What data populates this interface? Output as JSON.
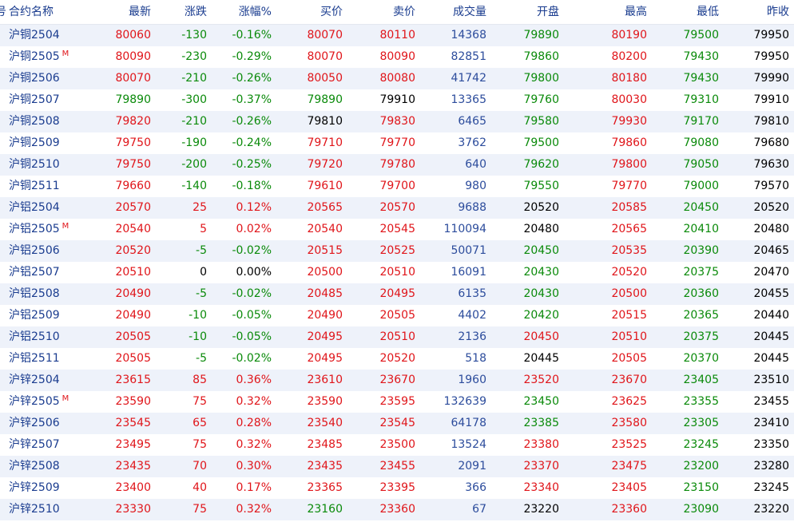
{
  "colors": {
    "up": "#e0151a",
    "down": "#0a8a0a",
    "flat": "#000000",
    "volume": "#2c4c9c",
    "name": "#1a3c8f"
  },
  "header": {
    "index_fragment": "号",
    "name": "合约名称",
    "last": "最新",
    "change": "涨跌",
    "change_pct": "涨幅%",
    "bid": "买价",
    "ask": "卖价",
    "volume": "成交量",
    "open": "开盘",
    "high": "最高",
    "low": "最低",
    "prev_close": "昨收"
  },
  "rows": [
    {
      "name": "沪铜2504",
      "main": "",
      "last": "80060",
      "change": "-130",
      "pct": "-0.16%",
      "bid": "80070",
      "ask": "80110",
      "volume": "14368",
      "open": "79890",
      "high": "80190",
      "low": "79500",
      "prev": "79950"
    },
    {
      "name": "沪铜2505",
      "main": "M",
      "last": "80090",
      "change": "-230",
      "pct": "-0.29%",
      "bid": "80070",
      "ask": "80090",
      "volume": "82851",
      "open": "79860",
      "high": "80200",
      "low": "79430",
      "prev": "79950"
    },
    {
      "name": "沪铜2506",
      "main": "",
      "last": "80070",
      "change": "-210",
      "pct": "-0.26%",
      "bid": "80050",
      "ask": "80080",
      "volume": "41742",
      "open": "79800",
      "high": "80180",
      "low": "79430",
      "prev": "79990"
    },
    {
      "name": "沪铜2507",
      "main": "",
      "last": "79890",
      "change": "-300",
      "pct": "-0.37%",
      "bid": "79890",
      "ask": "79910",
      "volume": "13365",
      "open": "79760",
      "high": "80030",
      "low": "79310",
      "prev": "79910"
    },
    {
      "name": "沪铜2508",
      "main": "",
      "last": "79820",
      "change": "-210",
      "pct": "-0.26%",
      "bid": "79810",
      "ask": "79830",
      "volume": "6465",
      "open": "79580",
      "high": "79930",
      "low": "79170",
      "prev": "79810"
    },
    {
      "name": "沪铜2509",
      "main": "",
      "last": "79750",
      "change": "-190",
      "pct": "-0.24%",
      "bid": "79710",
      "ask": "79770",
      "volume": "3762",
      "open": "79500",
      "high": "79860",
      "low": "79080",
      "prev": "79680"
    },
    {
      "name": "沪铜2510",
      "main": "",
      "last": "79750",
      "change": "-200",
      "pct": "-0.25%",
      "bid": "79720",
      "ask": "79780",
      "volume": "640",
      "open": "79620",
      "high": "79800",
      "low": "79050",
      "prev": "79630"
    },
    {
      "name": "沪铜2511",
      "main": "",
      "last": "79660",
      "change": "-140",
      "pct": "-0.18%",
      "bid": "79610",
      "ask": "79700",
      "volume": "980",
      "open": "79550",
      "high": "79770",
      "low": "79000",
      "prev": "79570"
    },
    {
      "name": "沪铝2504",
      "main": "",
      "last": "20570",
      "change": "25",
      "pct": "0.12%",
      "bid": "20565",
      "ask": "20570",
      "volume": "9688",
      "open": "20520",
      "high": "20585",
      "low": "20450",
      "prev": "20520"
    },
    {
      "name": "沪铝2505",
      "main": "M",
      "last": "20540",
      "change": "5",
      "pct": "0.02%",
      "bid": "20540",
      "ask": "20545",
      "volume": "110094",
      "open": "20480",
      "high": "20565",
      "low": "20410",
      "prev": "20480"
    },
    {
      "name": "沪铝2506",
      "main": "",
      "last": "20520",
      "change": "-5",
      "pct": "-0.02%",
      "bid": "20515",
      "ask": "20525",
      "volume": "50071",
      "open": "20450",
      "high": "20535",
      "low": "20390",
      "prev": "20465"
    },
    {
      "name": "沪铝2507",
      "main": "",
      "last": "20510",
      "change": "0",
      "pct": "0.00%",
      "bid": "20500",
      "ask": "20510",
      "volume": "16091",
      "open": "20430",
      "high": "20520",
      "low": "20375",
      "prev": "20470"
    },
    {
      "name": "沪铝2508",
      "main": "",
      "last": "20490",
      "change": "-5",
      "pct": "-0.02%",
      "bid": "20485",
      "ask": "20495",
      "volume": "6135",
      "open": "20430",
      "high": "20500",
      "low": "20360",
      "prev": "20455"
    },
    {
      "name": "沪铝2509",
      "main": "",
      "last": "20490",
      "change": "-10",
      "pct": "-0.05%",
      "bid": "20490",
      "ask": "20505",
      "volume": "4402",
      "open": "20420",
      "high": "20515",
      "low": "20365",
      "prev": "20440"
    },
    {
      "name": "沪铝2510",
      "main": "",
      "last": "20505",
      "change": "-10",
      "pct": "-0.05%",
      "bid": "20495",
      "ask": "20510",
      "volume": "2136",
      "open": "20450",
      "high": "20510",
      "low": "20375",
      "prev": "20445"
    },
    {
      "name": "沪铝2511",
      "main": "",
      "last": "20505",
      "change": "-5",
      "pct": "-0.02%",
      "bid": "20495",
      "ask": "20520",
      "volume": "518",
      "open": "20445",
      "high": "20505",
      "low": "20370",
      "prev": "20445"
    },
    {
      "name": "沪锌2504",
      "main": "",
      "last": "23615",
      "change": "85",
      "pct": "0.36%",
      "bid": "23610",
      "ask": "23670",
      "volume": "1960",
      "open": "23520",
      "high": "23670",
      "low": "23405",
      "prev": "23510"
    },
    {
      "name": "沪锌2505",
      "main": "M",
      "last": "23590",
      "change": "75",
      "pct": "0.32%",
      "bid": "23590",
      "ask": "23595",
      "volume": "132639",
      "open": "23450",
      "high": "23625",
      "low": "23355",
      "prev": "23455"
    },
    {
      "name": "沪锌2506",
      "main": "",
      "last": "23545",
      "change": "65",
      "pct": "0.28%",
      "bid": "23540",
      "ask": "23545",
      "volume": "64178",
      "open": "23385",
      "high": "23580",
      "low": "23305",
      "prev": "23410"
    },
    {
      "name": "沪锌2507",
      "main": "",
      "last": "23495",
      "change": "75",
      "pct": "0.32%",
      "bid": "23485",
      "ask": "23500",
      "volume": "13524",
      "open": "23380",
      "high": "23525",
      "low": "23245",
      "prev": "23350"
    },
    {
      "name": "沪锌2508",
      "main": "",
      "last": "23435",
      "change": "70",
      "pct": "0.30%",
      "bid": "23435",
      "ask": "23455",
      "volume": "2091",
      "open": "23370",
      "high": "23475",
      "low": "23200",
      "prev": "23280"
    },
    {
      "name": "沪锌2509",
      "main": "",
      "last": "23400",
      "change": "40",
      "pct": "0.17%",
      "bid": "23365",
      "ask": "23395",
      "volume": "366",
      "open": "23340",
      "high": "23405",
      "low": "23150",
      "prev": "23245"
    },
    {
      "name": "沪锌2510",
      "main": "",
      "last": "23330",
      "change": "75",
      "pct": "0.32%",
      "bid": "23160",
      "ask": "23360",
      "volume": "67",
      "open": "23220",
      "high": "23360",
      "low": "23090",
      "prev": "23220"
    }
  ]
}
